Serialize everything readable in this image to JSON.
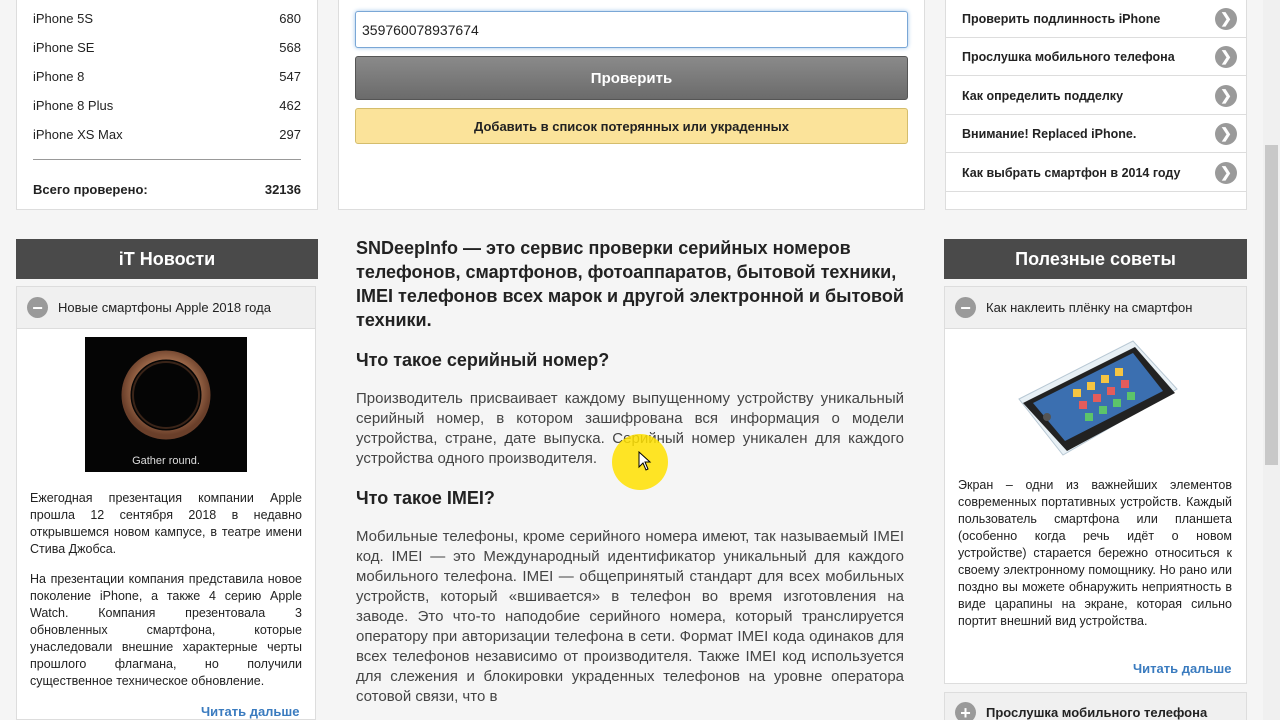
{
  "stats": {
    "rows": [
      {
        "name": "iPhone 5S",
        "count": "680"
      },
      {
        "name": "iPhone SE",
        "count": "568"
      },
      {
        "name": "iPhone 8",
        "count": "547"
      },
      {
        "name": "iPhone 8 Plus",
        "count": "462"
      },
      {
        "name": "iPhone XS Max",
        "count": "297"
      }
    ],
    "total_label": "Всего проверено:",
    "total_value": "32136"
  },
  "form": {
    "imei_value": "359760078937674",
    "check_label": "Проверить",
    "lost_label": "Добавить в список потерянных или украденных"
  },
  "links": [
    "Проверить подлинность iPhone",
    "Прослушка мобильного телефона",
    "Как определить подделку",
    "Внимание! Replaced iPhone.",
    "Как выбрать смартфон в 2014 году"
  ],
  "news": {
    "header": "iT Новости",
    "title": "Новые смартфоны Apple 2018 года",
    "image_caption": "Gather round.",
    "paragraph1": "Ежегодная презентация компании Apple прошла 12 сентября 2018 в недавно открывшемся новом кампусе, в театре имени Стива Джобса.",
    "paragraph2": "На презентации компания представила новое поколение iPhone, а также 4 серию Apple Watch. Компания презентовала 3 обновленных смартфона, которые унаследовали внешние характерные черты прошлого флагмана, но получили существенное техническое обновление.",
    "read_more": "Читать дальше"
  },
  "tips": {
    "header": "Полезные советы",
    "title": "Как наклеить плёнку на смартфон",
    "paragraph": "Экран – одни из важнейших элементов современных портативных устройств. Каждый пользователь смартфона или планшета (особенно когда речь идёт о новом устройстве) старается бережно относиться к своему электронному помощнику. Но рано или поздно вы можете обнаружить неприятность в виде царапины на экране, которая сильно портит внешний вид устройства.",
    "read_more": "Читать дальше",
    "next_title": "Прослушка мобильного телефона"
  },
  "article": {
    "intro": "SNDeepInfo — это сервис проверки серийных номеров телефонов, смартфонов, фотоаппаратов, бытовой техники, IMEI телефонов всех марок и другой электронной и бытовой техники.",
    "h_serial": "Что такое серийный номер?",
    "p_serial": "Производитель присваивает каждому выпущенному устройству уникальный серийный номер, в котором зашифрована вся информация о модели устройства, стране, дате выпуска. Серийный номер уникален для каждого устройства одного производителя.",
    "h_imei": "Что такое IMEI?",
    "p_imei": "Мобильные телефоны, кроме серийного номера имеют, так называемый IMEI код. IMEI — это Международный идентификатор уникальный для каждого мобильного телефона. IMEI — общепринятый стандарт для всех мобильных устройств, который «вшивается» в телефон во время изготовления на заводе. Это что-то наподобие серийного номера, который транслируется оператору при авторизации телефона в сети. Формат IMEI кода одинаков для всех телефонов независимо от производителя. Также IMEI код используется для слежения и блокировки украденных телефонов на уровне оператора сотовой связи, что в"
  }
}
